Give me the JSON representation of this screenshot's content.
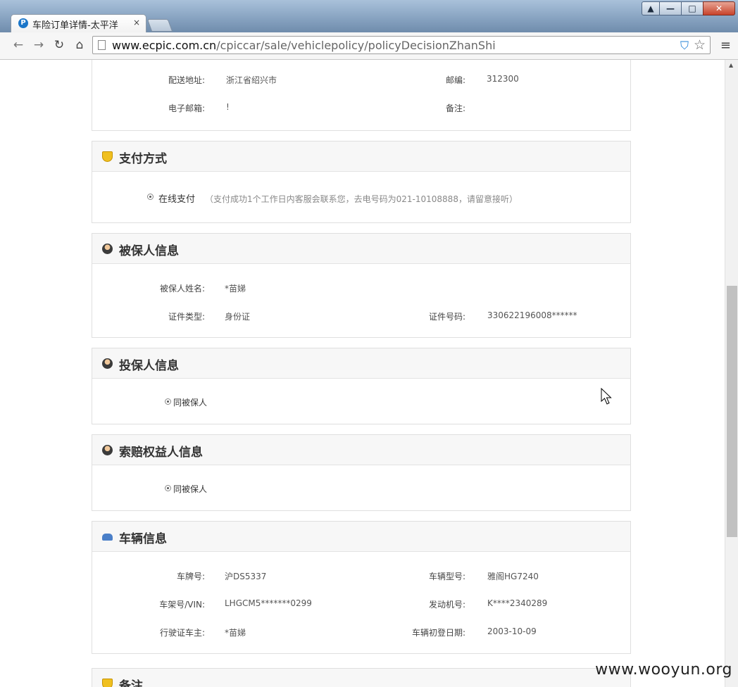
{
  "browser": {
    "tab_title": "车险订单详情-太平洋",
    "tab_close": "×",
    "url_host": "www.ecpic.com.cn",
    "url_path": "/cpiccar/sale/vehiclepolicy/policyDecisionZhanShi",
    "window_user": "▲",
    "window_minimize": "—",
    "window_maximize": "□",
    "window_close": "✕",
    "back": "←",
    "forward": "→",
    "reload": "↻",
    "home": "⌂",
    "menu": "≡",
    "star": "☆",
    "shield": "⛉"
  },
  "delivery": {
    "address_label": "配送地址:",
    "address_value": "浙江省绍兴市",
    "zip_label": "邮编:",
    "zip_value": "312300",
    "email_label": "电子邮箱:",
    "email_value": "!",
    "note_label": "备注:",
    "note_value": ""
  },
  "payment": {
    "title": "支付方式",
    "option_label": "在线支付",
    "option_note": "（支付成功1个工作日内客服会联系您，去电号码为021-10108888，请留意接听）"
  },
  "insured": {
    "title": "被保人信息",
    "name_label": "被保人姓名:",
    "name_value": "*苗娣",
    "id_type_label": "证件类型:",
    "id_type_value": "身份证",
    "id_no_label": "证件号码:",
    "id_no_value": "330622196008******"
  },
  "applicant": {
    "title": "投保人信息",
    "option_label": "同被保人"
  },
  "beneficiary": {
    "title": "索赔权益人信息",
    "option_label": "同被保人"
  },
  "vehicle": {
    "title": "车辆信息",
    "plate_label": "车牌号:",
    "plate_value": "沪DS5337",
    "model_label": "车辆型号:",
    "model_value": "雅阁HG7240",
    "vin_label": "车架号/VIN:",
    "vin_value": "LHGCM5*******0299",
    "engine_label": "发动机号:",
    "engine_value": "K****2340289",
    "owner_label": "行驶证车主:",
    "owner_value": "*苗娣",
    "reg_date_label": "车辆初登日期:",
    "reg_date_value": "2003-10-09"
  },
  "next_section": {
    "title": "备注"
  },
  "watermark": "www.wooyun.org"
}
